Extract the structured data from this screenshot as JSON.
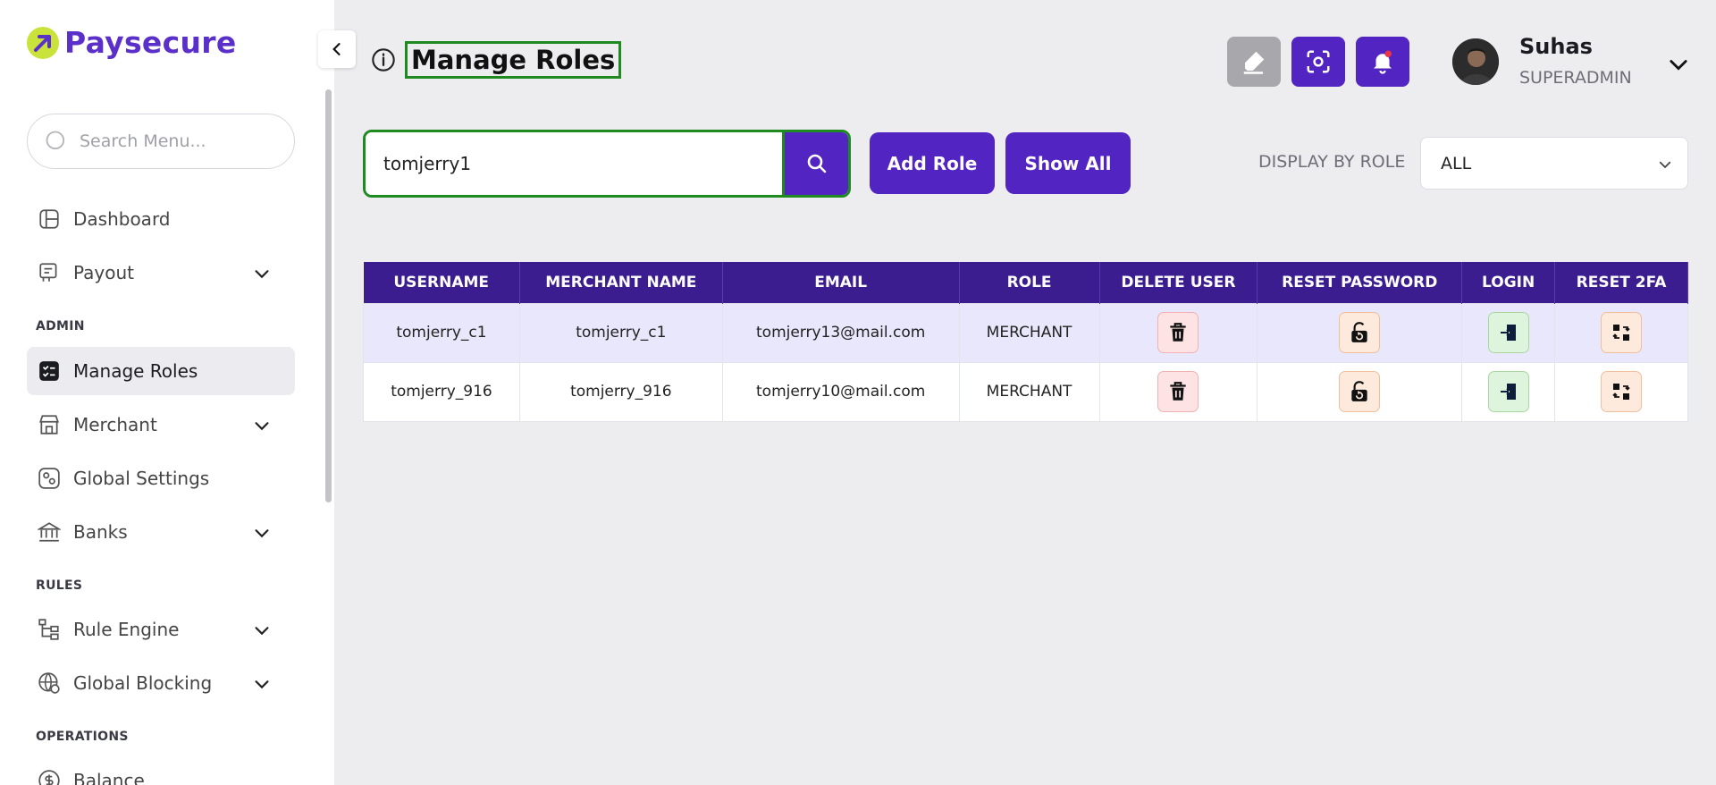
{
  "brand": {
    "name": "Paysecure",
    "accent": "#5224c2",
    "lime": "#c9e33a"
  },
  "sidebar": {
    "search_placeholder": "Search Menu...",
    "items": [
      {
        "label": "Dashboard"
      },
      {
        "label": "Payout"
      },
      {
        "label": "Manage Roles"
      },
      {
        "label": "Merchant"
      },
      {
        "label": "Global Settings"
      },
      {
        "label": "Banks"
      },
      {
        "label": "Rule Engine"
      },
      {
        "label": "Global Blocking"
      },
      {
        "label": "Balance"
      }
    ],
    "sections": {
      "admin": "ADMIN",
      "rules": "RULES",
      "operations": "OPERATIONS"
    }
  },
  "header": {
    "title": "Manage Roles",
    "user": {
      "name": "Suhas",
      "role": "SUPERADMIN"
    }
  },
  "toolbar": {
    "search_value": "tomjerry1",
    "add_role_label": "Add Role",
    "show_all_label": "Show All",
    "display_by_role_label": "DISPLAY BY ROLE",
    "role_select_value": "ALL"
  },
  "table": {
    "columns": [
      "USERNAME",
      "MERCHANT NAME",
      "EMAIL",
      "ROLE",
      "DELETE USER",
      "RESET PASSWORD",
      "LOGIN",
      "RESET 2FA"
    ],
    "rows": [
      {
        "username": "tomjerry_c1",
        "merchant_name": "tomjerry_c1",
        "email": "tomjerry13@mail.com",
        "role": "MERCHANT"
      },
      {
        "username": "tomjerry_916",
        "merchant_name": "tomjerry_916",
        "email": "tomjerry10@mail.com",
        "role": "MERCHANT"
      }
    ]
  }
}
